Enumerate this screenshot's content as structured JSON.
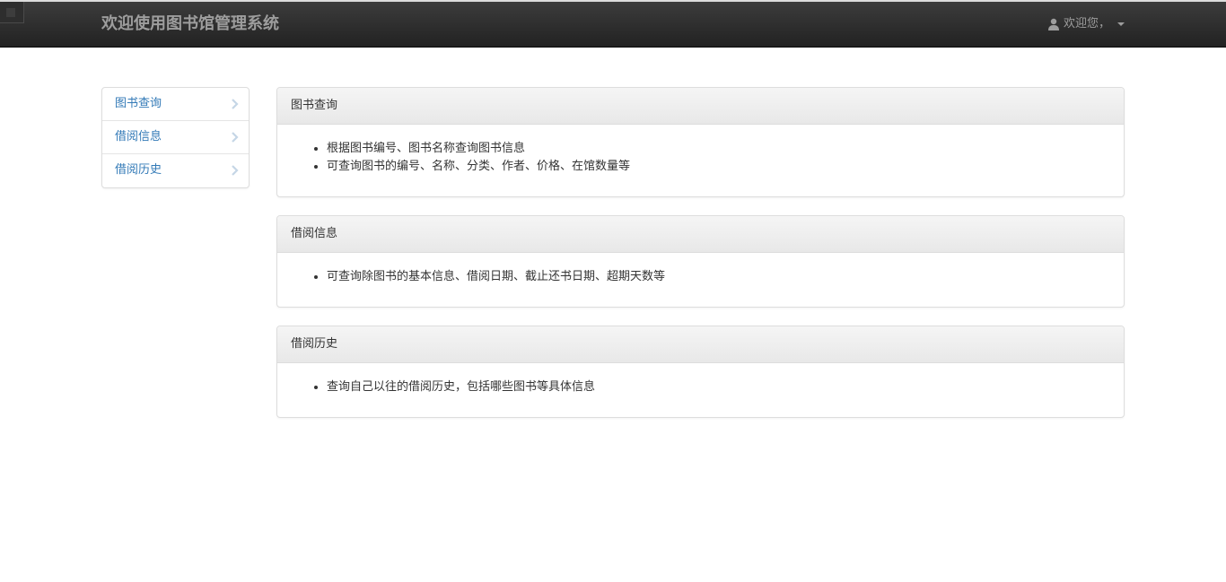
{
  "header": {
    "title": "欢迎使用图书馆管理系统",
    "user_label": "欢迎您，"
  },
  "sidebar": {
    "items": [
      {
        "label": "图书查询"
      },
      {
        "label": "借阅信息"
      },
      {
        "label": "借阅历史"
      }
    ]
  },
  "panels": [
    {
      "title": "图书查询",
      "bullets": [
        "根据图书编号、图书名称查询图书信息",
        "可查询图书的编号、名称、分类、作者、价格、在馆数量等"
      ]
    },
    {
      "title": "借阅信息",
      "bullets": [
        "可查询除图书的基本信息、借阅日期、截止还书日期、超期天数等"
      ]
    },
    {
      "title": "借阅历史",
      "bullets": [
        "查询自己以往的借阅历史，包括哪些图书等具体信息"
      ]
    }
  ],
  "icons": {
    "user": "user-icon",
    "caret": "caret-down-icon",
    "chevron": "chevron-right-icon"
  },
  "colors": {
    "navbar": "#222222",
    "link": "#337ab7",
    "muted_text": "#9d9d9d"
  }
}
